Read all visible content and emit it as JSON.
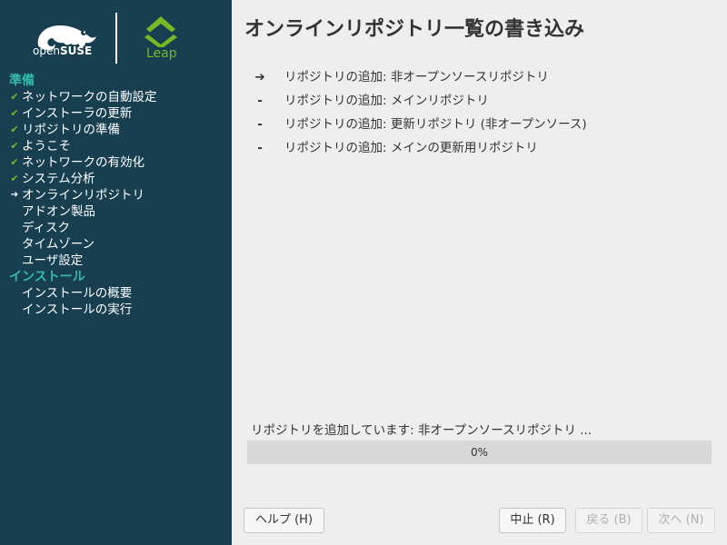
{
  "branding": {
    "opensuse_open": "open",
    "opensuse_suse": "SUSE",
    "leap": "Leap"
  },
  "sidebar": {
    "sections": [
      {
        "title": "準備",
        "items": [
          {
            "label": "ネットワークの自動設定",
            "state": "done"
          },
          {
            "label": "インストーラの更新",
            "state": "done"
          },
          {
            "label": "リポジトリの準備",
            "state": "done"
          },
          {
            "label": "ようこそ",
            "state": "done"
          },
          {
            "label": "ネットワークの有効化",
            "state": "done"
          },
          {
            "label": "システム分析",
            "state": "done"
          },
          {
            "label": "オンラインリポジトリ",
            "state": "current"
          },
          {
            "label": "アドオン製品",
            "state": "todo"
          },
          {
            "label": "ディスク",
            "state": "todo"
          },
          {
            "label": "タイムゾーン",
            "state": "todo"
          },
          {
            "label": "ユーザ設定",
            "state": "todo"
          }
        ]
      },
      {
        "title": "インストール",
        "items": [
          {
            "label": "インストールの概要",
            "state": "todo"
          },
          {
            "label": "インストールの実行",
            "state": "todo"
          }
        ]
      }
    ]
  },
  "main": {
    "title": "オンラインリポジトリ一覧の書き込み",
    "repos": [
      {
        "status": "➔",
        "text": "リポジトリの追加: 非オープンソースリポジトリ"
      },
      {
        "status": "-",
        "text": "リポジトリの追加: メインリポジトリ"
      },
      {
        "status": "-",
        "text": "リポジトリの追加: 更新リポジトリ (非オープンソース)"
      },
      {
        "status": "-",
        "text": "リポジトリの追加: メインの更新用リポジトリ"
      }
    ],
    "progress_label": "リポジトリを追加しています: 非オープンソースリポジトリ ...",
    "progress_fraction": 0,
    "progress_text": "0%"
  },
  "buttons": {
    "help": "ヘルプ (H)",
    "abort": "中止 (R)",
    "back": "戻る (B)",
    "next": "次へ (N)"
  },
  "colors": {
    "sidebar_bg": "#173f4f",
    "section_header": "#35b9ab",
    "check": "#73ba25",
    "main_bg": "#eeeeee"
  }
}
